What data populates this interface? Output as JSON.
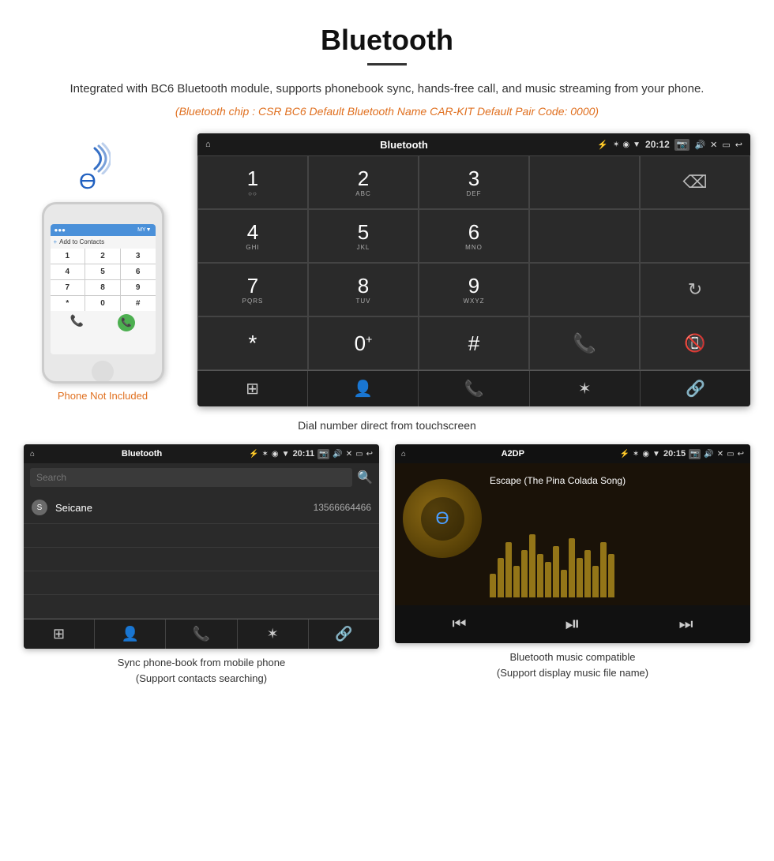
{
  "header": {
    "title": "Bluetooth",
    "description": "Integrated with BC6 Bluetooth module, supports phonebook sync, hands-free call, and music streaming from your phone.",
    "specs": "(Bluetooth chip : CSR BC6    Default Bluetooth Name CAR-KIT    Default Pair Code: 0000)"
  },
  "phone_aside": {
    "not_included_label": "Phone Not Included"
  },
  "head_unit": {
    "statusbar": {
      "home_icon": "⌂",
      "title": "Bluetooth",
      "usb_icon": "⚡",
      "bt_icon": "✶",
      "location_icon": "◉",
      "wifi_icon": "▼",
      "time": "20:12",
      "camera_icon": "📷",
      "volume_icon": "🔊",
      "close_icon": "✕",
      "window_icon": "▭",
      "back_icon": "↩"
    },
    "dialpad": {
      "keys": [
        {
          "num": "1",
          "letters": "○○"
        },
        {
          "num": "2",
          "letters": "ABC"
        },
        {
          "num": "3",
          "letters": "DEF"
        },
        {
          "num": "4",
          "letters": "GHI"
        },
        {
          "num": "5",
          "letters": "JKL"
        },
        {
          "num": "6",
          "letters": "MNO"
        },
        {
          "num": "7",
          "letters": "PQRS"
        },
        {
          "num": "8",
          "letters": "TUV"
        },
        {
          "num": "9",
          "letters": "WXYZ"
        },
        {
          "num": "*",
          "letters": ""
        },
        {
          "num": "0",
          "letters": "+"
        },
        {
          "num": "#",
          "letters": ""
        }
      ]
    },
    "navbar": {
      "items": [
        "⊞",
        "👤",
        "📞",
        "✶",
        "🔗"
      ]
    }
  },
  "caption_dial": "Dial number direct from touchscreen",
  "phonebook": {
    "statusbar": {
      "home_icon": "⌂",
      "title": "Bluetooth",
      "usb_icon": "⚡",
      "bt_icon": "✶",
      "time": "20:11",
      "camera_icon": "📷",
      "volume_icon": "🔊",
      "close_icon": "✕",
      "window_icon": "▭",
      "back_icon": "↩"
    },
    "search_placeholder": "Search",
    "contacts": [
      {
        "letter": "S",
        "name": "Seicane",
        "number": "13566664466"
      }
    ],
    "navbar": [
      "⊞",
      "👤",
      "📞",
      "✶",
      "🔗"
    ]
  },
  "caption_phonebook": "Sync phone-book from mobile phone\n(Support contacts searching)",
  "music": {
    "statusbar": {
      "home_icon": "⌂",
      "title": "A2DP",
      "usb_icon": "⚡",
      "bt_icon": "✶",
      "time": "20:15",
      "camera_icon": "📷",
      "volume_icon": "🔊",
      "close_icon": "✕",
      "window_icon": "▭",
      "back_icon": "↩"
    },
    "song_title": "Escape (The Pina Colada Song)",
    "eq_bars": [
      30,
      50,
      70,
      40,
      60,
      80,
      55,
      45,
      65,
      35,
      75,
      50,
      60,
      40,
      70,
      55
    ],
    "controls": {
      "prev": "⏮",
      "play_pause": "⏯",
      "next": "⏭"
    }
  },
  "caption_music": "Bluetooth music compatible\n(Support display music file name)",
  "phone_keypad": {
    "keys": [
      "1",
      "2",
      "3",
      "4",
      "5",
      "6",
      "7",
      "8",
      "9",
      "*",
      "0",
      "#"
    ]
  }
}
